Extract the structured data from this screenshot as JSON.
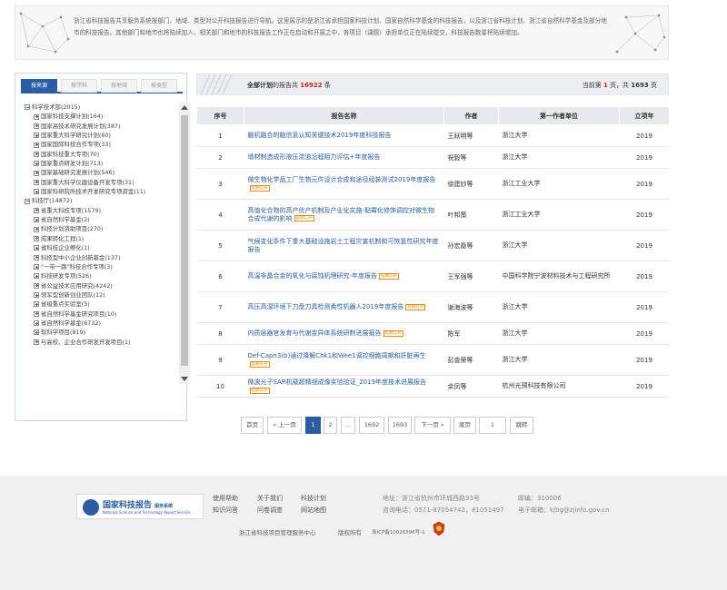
{
  "intro": {
    "text": "浙江省科技报告共享服务系统按部门、地域、类型对公开科技报告进行导航。这里展示的是浙江省承担国家科技计划、国家自然科学基金的科技报告，以及浙江省科技计划、浙江省自然科学基金及部分地市的科技报告。其他部门和地市也将陆续加入，相关部门和地市的科技报告工作正在启动和开展之中，各项目（课题）承担单位正在陆续提交，科技报告数量将陆续增加。"
  },
  "tabs": [
    {
      "label": "按来源",
      "active": true
    },
    {
      "label": "按学科",
      "active": false
    },
    {
      "label": "按地域",
      "active": false
    },
    {
      "label": "按类型",
      "active": false
    }
  ],
  "tree": [
    {
      "label": "科学技术部(2015)",
      "level": 0,
      "expanded": true
    },
    {
      "label": "国家科技支撑计划(164)",
      "level": 1
    },
    {
      "label": "国家高技术研究发展计划(387)",
      "level": 1
    },
    {
      "label": "国家重大科学研究计划(60)",
      "level": 1
    },
    {
      "label": "国家国际科技合作专项(33)",
      "level": 1
    },
    {
      "label": "国家科技重大专项(70)",
      "level": 1
    },
    {
      "label": "国家重点研发计划(713)",
      "level": 1
    },
    {
      "label": "国家基础研究发展计划(546)",
      "level": 1
    },
    {
      "label": "国家重大科学仪器设备开发专项(31)",
      "level": 1
    },
    {
      "label": "国家科研院所技术开发研究专项资金(11)",
      "level": 1
    },
    {
      "label": "科技厅(14872)",
      "level": 0,
      "expanded": true
    },
    {
      "label": "省重大科技专项(1579)",
      "level": 1
    },
    {
      "label": "省自然科学基金(2)",
      "level": 1
    },
    {
      "label": "科技计划资助项目(270)",
      "level": 1
    },
    {
      "label": "成果转化工程(1)",
      "level": 1
    },
    {
      "label": "省科技企业孵化(1)",
      "level": 1
    },
    {
      "label": "科技型中小企业创新基金(137)",
      "level": 1
    },
    {
      "label": "\"一带一路\"科技合作专项(3)",
      "level": 1
    },
    {
      "label": "科技研发专项(526)",
      "level": 1
    },
    {
      "label": "省公益技术应用研究(4242)",
      "level": 1
    },
    {
      "label": "领军型创新创业团队(12)",
      "level": 1
    },
    {
      "label": "省级重点实验室(5)",
      "level": 1
    },
    {
      "label": "省自然科学基金研究项目(10)",
      "level": 1
    },
    {
      "label": "省自然科学基金(6732)",
      "level": 1
    },
    {
      "label": "软科学项目(819)",
      "level": 1
    },
    {
      "label": "与高校、企业合作研发开发项目(1)",
      "level": 1
    }
  ],
  "summary": {
    "prefix": "全部计划",
    "middle": "的报告共",
    "count": "16922",
    "suffix": "条",
    "page_prefix": "当前第",
    "page": "1",
    "page_mid": "页，共",
    "total_pages": "1693",
    "page_suffix": "页"
  },
  "table": {
    "headers": [
      "序号",
      "报告名称",
      "作者",
      "第一作者单位",
      "立项年"
    ],
    "rows": [
      {
        "no": "1",
        "title": "脑机融合的脑信息认知关键技术2019年度科技报告",
        "tag": "",
        "author": "王跃明等",
        "unit": "浙江大学",
        "year": "2019"
      },
      {
        "no": "2",
        "title": "增材制造成形液压流道沿程阻力评估+年度报告",
        "tag": "",
        "author": "祝毅等",
        "unit": "浙江大学",
        "year": "2019"
      },
      {
        "no": "3",
        "title": "微生物化学品工厂生物元件设计合成和途径组装测试2019年度报告",
        "tag": "延期公开",
        "author": "徐建妙等",
        "unit": "浙江工业大学",
        "year": "2019"
      },
      {
        "no": "4",
        "title": "高值化合物的高产优产机制及产业化实施-黏霉化修饰调控对微生物合成代谢的影响",
        "tag": "延期公开",
        "author": "叶邦策",
        "unit": "浙江工业大学",
        "year": "2019"
      },
      {
        "no": "5",
        "title": "气候变化条件下重大基础设施岩土工程灾害机制和可恢复性研究年度报告",
        "tag": "",
        "author": "孙宏磊等",
        "unit": "浙江大学",
        "year": "2019"
      },
      {
        "no": "6",
        "title": "高温非晶合金的氧化与腐蚀机理研究-年度报告",
        "tag": "延期公开",
        "author": "王军强等",
        "unit": "中国科学院宁波材料技术与工程研究所",
        "year": "2019"
      },
      {
        "no": "7",
        "title": "高压高湿环境下刀盘刀具检测柔性机器人2019年度报告",
        "tag": "延期公开",
        "author": "谢海波等",
        "unit": "浙江大学",
        "year": "2019"
      },
      {
        "no": "8",
        "title": "内质层器官发育与代谢变异体系统研制进展报告",
        "tag": "延期公开",
        "author": "陈军",
        "unit": "浙江大学",
        "year": "2019"
      },
      {
        "no": "9",
        "title": "Def-Capn3(b)通过降解Chk1和Wee1调控细胞周期和肝脏再生",
        "tag": "延期公开",
        "author": "彭金荣等",
        "unit": "浙江大学",
        "year": "2019"
      },
      {
        "no": "10",
        "title": "微波光子SAR机载超精细成像实验验证_2019年度技术进展报告",
        "tag": "延期公开",
        "author": "余凤等",
        "unit": "杭州光预科技有限公司",
        "year": "2019"
      }
    ]
  },
  "pagination": {
    "first": "首页",
    "prev": "« 上一页",
    "p1": "1",
    "p2": "2",
    "ellipsis": "...",
    "p1692": "1692",
    "p1693": "1693",
    "next": "下一页 »",
    "last": "尾页",
    "jump_value": "1",
    "jump": "跳转"
  },
  "footer": {
    "logo_cn": "国家科技报告",
    "logo_cn_small": "服务系统",
    "logo_en": "National Science and Technology Report Service",
    "links": [
      "使用帮助",
      "关于我们",
      "科技计划",
      "知识问答",
      "问卷调查",
      "网站地图"
    ],
    "address": "地址：浙江省杭州市环城西路33号",
    "postcode": "邮编：310006",
    "phone": "咨询电话：0571-87054742，81051497",
    "email": "电子邮箱：kjbg@zjinfo.gov.cn",
    "org": "浙江省科技项目管理服务中心",
    "rights": "版权所有",
    "icp": "浙ICP备10026396号-1"
  }
}
